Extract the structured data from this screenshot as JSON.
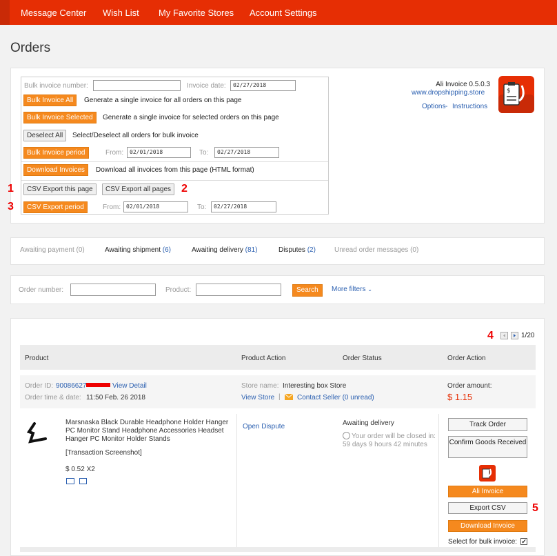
{
  "nav": {
    "items": [
      "Message Center",
      "Wish List",
      "My Favorite Stores",
      "Account Settings"
    ]
  },
  "page": {
    "title": "Orders"
  },
  "bulk": {
    "invoice_number_label": "Bulk invoice number:",
    "invoice_number_value": "",
    "invoice_date_label": "Invoice date:",
    "invoice_date_value": "02/27/2018",
    "bulk_all_label": "Bulk Invoice All",
    "bulk_all_desc": "Generate a single invoice for all orders on this page",
    "bulk_selected_label": "Bulk Invoice Selected",
    "bulk_selected_desc": "Generate a single invoice for selected orders on this page",
    "deselect_label": "Deselect All",
    "deselect_desc": "Select/Deselect all orders for bulk invoice",
    "bulk_period_label": "Bulk Invoice period",
    "from_label": "From:",
    "to_label": "To:",
    "period_from": "02/01/2018",
    "period_to": "02/27/2018",
    "download_label": "Download Invoices",
    "download_desc": "Download all invoices from this page (HTML format)",
    "csv_page_label": "CSV Export this page",
    "csv_all_label": "CSV Export all pages",
    "csv_period_label": "CSV Export period",
    "csv_from": "02/01/2018",
    "csv_to": "02/27/2018"
  },
  "plugin": {
    "name": "Ali Invoice 0.5.0.3",
    "site": "www.dropshipping.store",
    "options": "Options",
    "sep": " - ",
    "instructions": "Instructions"
  },
  "markers": [
    "1",
    "2",
    "3",
    "4",
    "5"
  ],
  "tabs": [
    {
      "label": "Awaiting payment",
      "count": "(0)"
    },
    {
      "label": "Awaiting shipment",
      "count": "(6)"
    },
    {
      "label": "Awaiting delivery",
      "count": "(81)"
    },
    {
      "label": "Disputes",
      "count": "(2)"
    },
    {
      "label": "Unread order messages",
      "count": "(0)"
    }
  ],
  "filters": {
    "order_label": "Order number:",
    "product_label": "Product:",
    "search_label": "Search",
    "more_label": "More filters"
  },
  "pagination": {
    "text": "1/20"
  },
  "table": {
    "headers": [
      "Product",
      "Product Action",
      "Order Status",
      "Order Action"
    ]
  },
  "order": {
    "id_label": "Order ID:",
    "id_value": "90086627",
    "view_detail": "View Detail",
    "time_label": "Order time & date:",
    "time_value": "11:50 Feb. 26 2018",
    "store_label": "Store name:",
    "store_value": "Interesting box Store",
    "view_store": "View Store",
    "contact_seller": "Contact Seller",
    "unread": "(0 unread)",
    "amount_label": "Order amount:",
    "amount_value": "$ 1.15",
    "product_title": "Marsnaska Black Durable Headphone Holder Hanger PC Monitor Stand Headphone Accessories Headset Hanger PC Monitor Holder Stands",
    "screenshot": "[Transaction Screenshot]",
    "price": "$ 0.52 X2",
    "open_dispute": "Open Dispute",
    "status": "Awaiting delivery",
    "close_note": "Your order will be closed in: 59 days 9 hours 42 minutes",
    "track_label": "Track Order",
    "confirm_label": "Confirm Goods Received",
    "ali_invoice_label": "Ali Invoice",
    "export_csv_label": "Export CSV",
    "download_invoice_label": "Download Invoice",
    "select_bulk_label": "Select for bulk invoice:"
  },
  "colors": {
    "nav": "#e62e04",
    "orange": "#f5891e",
    "link": "#2a5fb0",
    "price": "#e62e04",
    "marker": "#ee0000"
  },
  "icons": [
    "clipboard-invoice-icon",
    "clock-icon",
    "mail-icon",
    "chevron-down-icon",
    "prev-page-icon",
    "next-page-icon",
    "truck-icon",
    "card-icon",
    "checkbox-icon"
  ]
}
